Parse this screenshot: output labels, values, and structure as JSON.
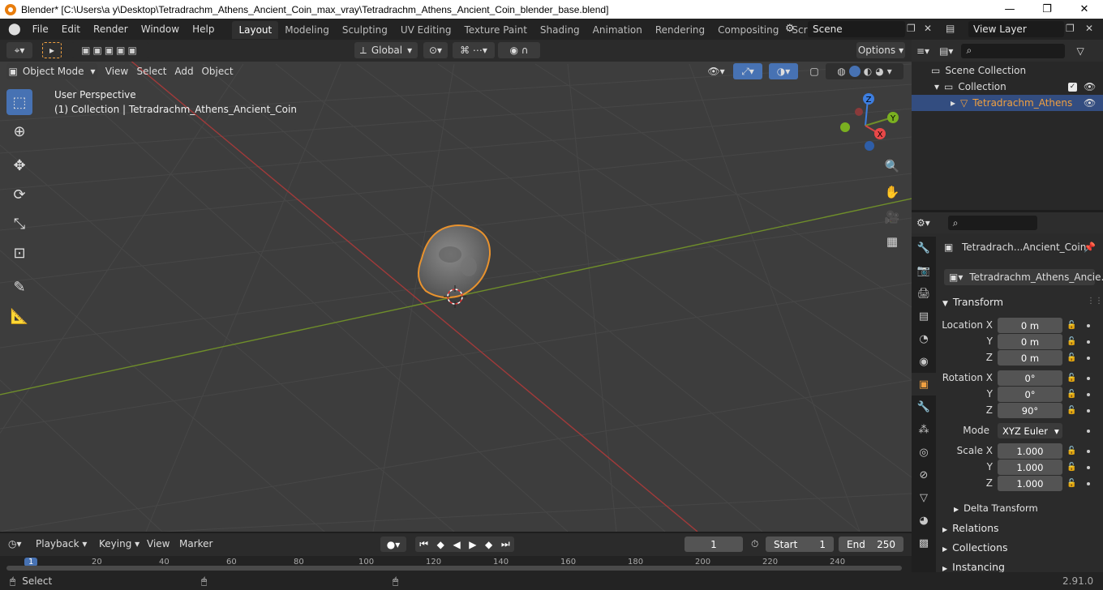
{
  "window": {
    "title": "Blender* [C:\\Users\\a y\\Desktop\\Tetradrachm_Athens_Ancient_Coin_max_vray\\Tetradrachm_Athens_Ancient_Coin_blender_base.blend]",
    "minimize": "—",
    "maximize": "❐",
    "close": "✕"
  },
  "menu": [
    "File",
    "Edit",
    "Render",
    "Window",
    "Help"
  ],
  "workspaces": [
    "Layout",
    "Modeling",
    "Sculpting",
    "UV Editing",
    "Texture Paint",
    "Shading",
    "Animation",
    "Rendering",
    "Compositing",
    "Scripting"
  ],
  "scene": {
    "label": "Scene",
    "view_layer": "View Layer"
  },
  "viewport": {
    "mode": "Object Mode",
    "menus": [
      "View",
      "Select",
      "Add",
      "Object"
    ],
    "transform_orientation": "Global",
    "options": "Options",
    "perspective": "User Perspective",
    "collection_info": "(1) Collection | Tetradrachm_Athens_Ancient_Coin",
    "gizmo": {
      "x": "X",
      "y": "Y",
      "z": "Z"
    }
  },
  "outliner": {
    "scene_collection": "Scene Collection",
    "collection": "Collection",
    "object": "Tetradrachm_Athens"
  },
  "properties": {
    "object_name": "Tetradrach...Ancient_Coin",
    "object_dropdown": "Tetradrachm_Athens_Ancie...",
    "transform": {
      "title": "Transform",
      "location_label": "Location X",
      "loc": [
        "0 m",
        "0 m",
        "0 m"
      ],
      "rotation_label": "Rotation X",
      "rot": [
        "0°",
        "0°",
        "90°"
      ],
      "mode_label": "Mode",
      "mode": "XYZ Euler",
      "scale_label": "Scale X",
      "scale": [
        "1.000",
        "1.000",
        "1.000"
      ],
      "y": "Y",
      "z": "Z",
      "delta": "Delta Transform"
    },
    "sections": [
      "Relations",
      "Collections",
      "Instancing"
    ]
  },
  "timeline": {
    "menus": [
      "Playback",
      "Keying",
      "View",
      "Marker"
    ],
    "current_frame": "1",
    "start_label": "Start",
    "start": "1",
    "end_label": "End",
    "end": "250",
    "ruler": [
      "1",
      "20",
      "40",
      "60",
      "80",
      "100",
      "120",
      "140",
      "160",
      "180",
      "200",
      "220",
      "240"
    ]
  },
  "status": {
    "select": "Select",
    "version": "2.91.0"
  },
  "colors": {
    "accent": "#4772b3",
    "selection_outline": "#e8922e",
    "x_axis": "#a23a3a",
    "y_axis": "#6f8e2a"
  }
}
